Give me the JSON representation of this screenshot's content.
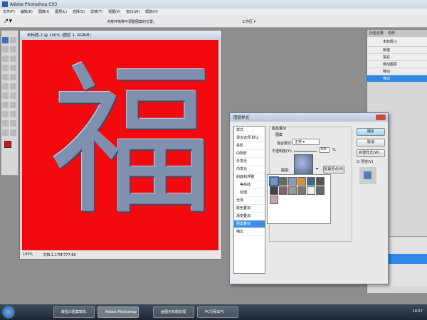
{
  "app": {
    "title": "Adobe Photoshop CS3"
  },
  "menu": [
    "文件(F)",
    "编辑(E)",
    "图像(I)",
    "图层(L)",
    "选择(S)",
    "滤镜(T)",
    "视图(V)",
    "窗口(W)",
    "帮助(H)"
  ],
  "options": {
    "hint": "点按并拖移可调整图案的位置。",
    "workspace": "工作区 ▾"
  },
  "document": {
    "title": "未标题-2 @ 100% (图层 1, RGB/8)",
    "zoom": "100%",
    "info": "文档:1.17M/777.6K",
    "artwork": "福",
    "canvas_color": "#f20a0e"
  },
  "dialog": {
    "title": "图层样式",
    "styles": [
      "样式",
      "混合选项:默认",
      "投影",
      "内阴影",
      "外发光",
      "内发光",
      "斜面和浮雕",
      "等高线",
      "纹理",
      "光泽",
      "颜色叠加",
      "渐变叠加",
      "图案叠加",
      "描边"
    ],
    "selected": "图案叠加",
    "section": "图案叠加",
    "group": "图案",
    "blend_label": "混合模式:",
    "blend_value": "正常",
    "opacity_label": "不透明度(Y):",
    "opacity_value": "100",
    "opacity_unit": "%",
    "pattern_label": "图案:",
    "snap_button": "贴紧原点(A)",
    "ok": "确定",
    "cancel": "取消",
    "new_style": "新建样式(W)...",
    "preview": "预览(V)"
  },
  "history": {
    "tabs": [
      "历史记录",
      "动作"
    ],
    "snapshot": "未标题-1",
    "items": [
      "新建",
      "填充",
      "移动图层",
      "移动",
      "移动"
    ]
  },
  "taskbar": {
    "items": [
      "教程/2图案填充.",
      "Adobe Photoshop",
      "画图无标题处理",
      "PC行程出气"
    ],
    "clock": "10:57"
  }
}
